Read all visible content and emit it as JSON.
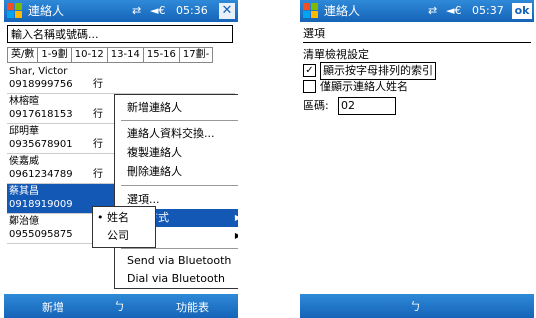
{
  "device1": {
    "title": "連絡人",
    "time": "05:36",
    "search_placeholder": "輸入名稱或號碼...",
    "tabs": [
      "英/數",
      "1-9劃",
      "10-12",
      "13-14",
      "15-16",
      "17劃-"
    ],
    "contacts": [
      {
        "name": "Shar, Victor",
        "phone": "0918999756",
        "type": "行"
      },
      {
        "name": "林榕暄",
        "phone": "0917618153",
        "type": "行"
      },
      {
        "name": "邱明華",
        "phone": "0935678901",
        "type": "行"
      },
      {
        "name": "侯嘉威",
        "phone": "0961234789",
        "type": "行"
      },
      {
        "name": "蔡其昌",
        "phone": "0918919009",
        "type": ""
      },
      {
        "name": "鄭治億",
        "phone": "0955095875",
        "type": "行"
      }
    ],
    "menu": {
      "items": [
        "新增連絡人",
        "連絡人資料交換...",
        "複製連絡人",
        "刪除連絡人",
        "選項...",
        "方式",
        "",
        "Send via Bluetooth",
        "Dial via Bluetooth"
      ]
    },
    "submenu": {
      "items": [
        "姓名",
        "公司"
      ],
      "bullet": "•"
    },
    "bottom": {
      "left": "新增",
      "mid": "ㄅ",
      "right": "功能表"
    }
  },
  "device2": {
    "title": "連絡人",
    "time": "05:37",
    "ok_label": "ok",
    "section_title": "選項",
    "subhead": "清單檢視設定",
    "options": [
      {
        "label": "顯示按字母排列的索引",
        "checked": true
      },
      {
        "label": "僅顯示連絡人姓名",
        "checked": false
      }
    ],
    "area_label": "區碼:",
    "area_value": "02",
    "bottom": {
      "mid": "ㄅ"
    }
  },
  "icons": {
    "sync": "⇄",
    "volume": "◄€",
    "close": "✕",
    "check": "✓"
  },
  "colors": {
    "titlebar": "#1563b8",
    "selection": "#1458b5"
  }
}
